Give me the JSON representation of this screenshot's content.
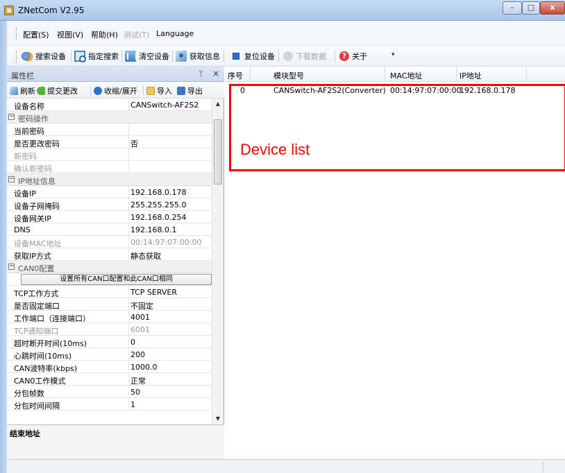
{
  "window": {
    "title": "ZNetCom V2.95"
  },
  "menu": [
    {
      "label": "配置(S)",
      "enabled": true
    },
    {
      "label": "视图(V)",
      "enabled": true
    },
    {
      "label": "帮助(H)",
      "enabled": true
    },
    {
      "label": "测试(T)",
      "enabled": false
    },
    {
      "label": "Language",
      "enabled": true
    }
  ],
  "toolbar": {
    "search_devices": "搜索设备",
    "specified_search": "指定搜索",
    "clear_devices": "清空设备",
    "get_info": "获取信息",
    "reset_device": "复位设备",
    "download_data": "下载数据",
    "about": "关于"
  },
  "property_pane": {
    "title": "属性栏",
    "pin_glyph": "ᛘ",
    "close_glyph": "×",
    "toolbar": {
      "refresh": "刷新",
      "submit": "提交更改",
      "collapse_expand": "收缩/展开",
      "import": "导入",
      "export": "导出"
    },
    "device_name": {
      "name": "设备名称",
      "value": "CANSwitch-AF2S2"
    },
    "password_section": {
      "title": "密码操作",
      "rows": [
        {
          "name": "当前密码",
          "value": ""
        },
        {
          "name": "是否更改密码",
          "value": "否"
        },
        {
          "name": "新密码",
          "value": ""
        },
        {
          "name": "确认新密码",
          "value": ""
        }
      ]
    },
    "ip_section": {
      "title": "IP地址信息",
      "rows": [
        {
          "name": "设备IP",
          "value": "192.168.0.178"
        },
        {
          "name": "设备子网掩码",
          "value": "255.255.255.0"
        },
        {
          "name": "设备网关IP",
          "value": "192.168.0.254"
        },
        {
          "name": "DNS",
          "value": "192.168.0.1"
        },
        {
          "name": "设备MAC地址",
          "value": "00:14:97:07:00:00"
        },
        {
          "name": "获取IP方式",
          "value": "静态获取"
        }
      ]
    },
    "can_section": {
      "title": "CAN0配置",
      "apply_all_button": "设置所有CAN口配置和此CAN口相同",
      "rows": [
        {
          "name": "TCP工作方式",
          "value": "TCP SERVER"
        },
        {
          "name": "是否固定端口",
          "value": "不固定"
        },
        {
          "name": "工作端口（连接端口）",
          "value": "4001"
        },
        {
          "name": "TCP通知端口",
          "value": "6001"
        },
        {
          "name": "超时断开时间(10ms)",
          "value": "0"
        },
        {
          "name": "心跳时间(10ms)",
          "value": "200"
        },
        {
          "name": "CAN波特率(kbps)",
          "value": "1000.0"
        },
        {
          "name": "CAN0工作模式",
          "value": "正常"
        },
        {
          "name": "分包帧数",
          "value": "50"
        },
        {
          "name": "分包时间间隔",
          "value": "1"
        }
      ]
    },
    "description_title": "结束地址"
  },
  "device_list": {
    "columns": [
      "序号",
      "模块型号",
      "MAC地址",
      "IP地址"
    ],
    "rows": [
      {
        "index": "0",
        "model": "CANSwitch-AF2S2(Converter)",
        "mac": "00:14:97:07:00:00",
        "ip": "192.168.0.178"
      }
    ],
    "annotation": "Device list",
    "annotation_color": "#ff0000"
  },
  "icons": {
    "search": "magnifier-device-icon",
    "specified_search": "target-search-icon",
    "clear": "clear-list-icon",
    "get_info": "get-info-icon",
    "reset": "blue-square-icon",
    "download": "download-icon",
    "about": "question-icon"
  }
}
